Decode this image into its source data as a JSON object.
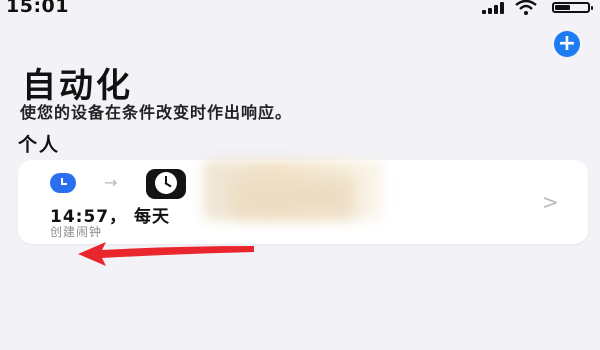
{
  "status_bar": {
    "time": "15:01",
    "battery_level": 0.5
  },
  "header": {
    "title": "自动化",
    "subtitle": "使您的设备在条件改变时作出响应。",
    "add_label": "+"
  },
  "section": {
    "title": "个人"
  },
  "automation": {
    "time_text": "14:57，  每天",
    "action_text": "创建闹钟",
    "icons": [
      "clock-trigger-icon",
      "arrow-icon",
      "clock-app-icon",
      "chevron-right-icon"
    ]
  },
  "colors": {
    "accent": "#1e7cf2",
    "annotation_arrow": "#e8262c"
  }
}
